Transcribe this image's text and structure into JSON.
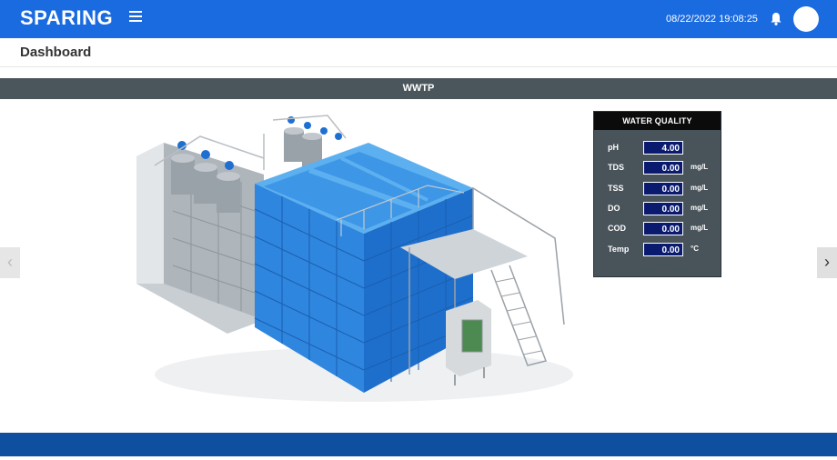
{
  "header": {
    "brand": "SPARING",
    "datetime": "08/22/2022 19:08:25",
    "menu_icon": "hamburger-icon",
    "bell_icon": "bell-icon"
  },
  "page": {
    "title": "Dashboard"
  },
  "section": {
    "title": "WWTP"
  },
  "carousel": {
    "prev": "‹",
    "next": "›"
  },
  "water_quality": {
    "title": "WATER QUALITY",
    "rows": [
      {
        "label": "pH",
        "value": "4.00",
        "unit": ""
      },
      {
        "label": "TDS",
        "value": "0.00",
        "unit": "mg/L"
      },
      {
        "label": "TSS",
        "value": "0.00",
        "unit": "mg/L"
      },
      {
        "label": "DO",
        "value": "0.00",
        "unit": "mg/L"
      },
      {
        "label": "COD",
        "value": "0.00",
        "unit": "mg/L"
      },
      {
        "label": "Temp",
        "value": "0.00",
        "unit": "°C"
      }
    ]
  },
  "colors": {
    "topbar": "#1a6be0",
    "section_header": "#4b565c",
    "panel": "#48535a",
    "value_box": "#0a1a6e",
    "footer": "#0f4fa0"
  }
}
